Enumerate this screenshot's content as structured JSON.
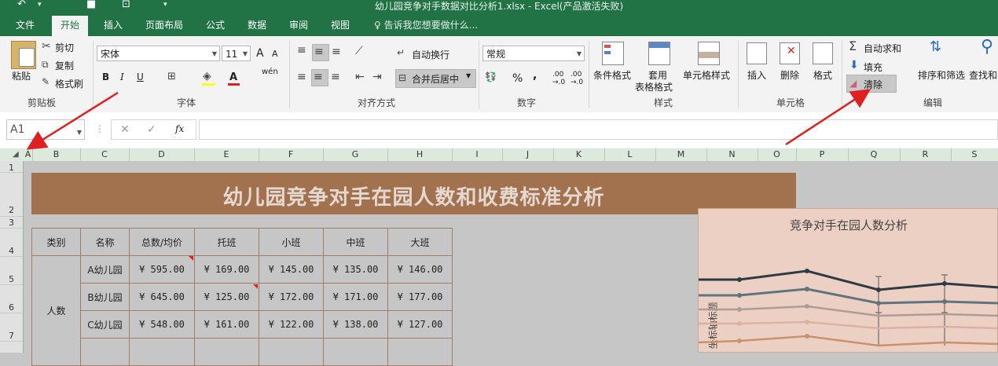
{
  "title_bar": {
    "title": "幼儿园竞争对手数据对比分析1.xlsx - Excel(产品激活失败)"
  },
  "tabs": [
    {
      "label": "文件"
    },
    {
      "label": "开始",
      "active": true
    },
    {
      "label": "插入"
    },
    {
      "label": "页面布局"
    },
    {
      "label": "公式"
    },
    {
      "label": "数据"
    },
    {
      "label": "审阅"
    },
    {
      "label": "视图"
    }
  ],
  "tell_me": "告诉我您想要做什么...",
  "ribbon": {
    "clipboard": {
      "paste": "粘贴",
      "cut": "剪切",
      "copy": "复制",
      "format_painter": "格式刷",
      "label": "剪贴板"
    },
    "font": {
      "name": "宋体",
      "size": "11",
      "bold": "B",
      "italic": "I",
      "underline": "U",
      "label": "字体",
      "grow": "A",
      "shrink": "A"
    },
    "alignment": {
      "wrap": "自动换行",
      "merge": "合并后居中",
      "label": "对齐方式"
    },
    "number": {
      "format": "常规",
      "label": "数字",
      "percent": "%",
      "comma": ","
    },
    "styles": {
      "conditional": "条件格式",
      "table_line1": "套用",
      "table_line2": "表格格式",
      "cell_styles": "单元格样式",
      "label": "样式"
    },
    "cells": {
      "insert": "插入",
      "delete": "删除",
      "format": "格式",
      "label": "单元格"
    },
    "editing": {
      "autosum": "自动求和",
      "fill": "填充",
      "clear": "清除",
      "sort_filter": "排序和筛选",
      "find": "查找和",
      "label": "编辑"
    }
  },
  "formula_bar": {
    "name_box": "A1",
    "fx": "fx",
    "formula": ""
  },
  "columns": [
    "A",
    "B",
    "C",
    "D",
    "E",
    "F",
    "G",
    "H",
    "I",
    "J",
    "K",
    "L",
    "M",
    "N",
    "O",
    "P",
    "Q",
    "R",
    "S"
  ],
  "rows": [
    "1",
    "2",
    "3",
    "4",
    "5",
    "6",
    "7"
  ],
  "sheet": {
    "banner_title": "幼儿园竞争对手在园人数和收费标准分析",
    "table": {
      "headers": [
        "类别",
        "名称",
        "总数/均价",
        "托班",
        "小班",
        "中班",
        "大班"
      ],
      "category": "人数",
      "rows": [
        {
          "name": "A幼儿园",
          "values": [
            "¥ 595.00",
            "¥ 169.00",
            "¥ 145.00",
            "¥ 135.00",
            "¥ 146.00"
          ]
        },
        {
          "name": "B幼儿园",
          "values": [
            "¥ 645.00",
            "¥ 125.00",
            "¥ 172.00",
            "¥ 171.00",
            "¥ 177.00"
          ]
        },
        {
          "name": "C幼儿园",
          "values": [
            "¥ 548.00",
            "¥ 161.00",
            "¥ 122.00",
            "¥ 138.00",
            "¥ 127.00"
          ]
        }
      ]
    }
  },
  "chart": {
    "title": "竞争对手在园人数分析",
    "ylabel": "坐标轴标题",
    "colors": [
      "#2e3a44",
      "#5f7480",
      "#b09c96",
      "#d9b2a4",
      "#c9926e"
    ]
  },
  "colors": {
    "excel_green": "#217346",
    "banner": "#a2724f",
    "annotation_arrow": "#e02020"
  }
}
